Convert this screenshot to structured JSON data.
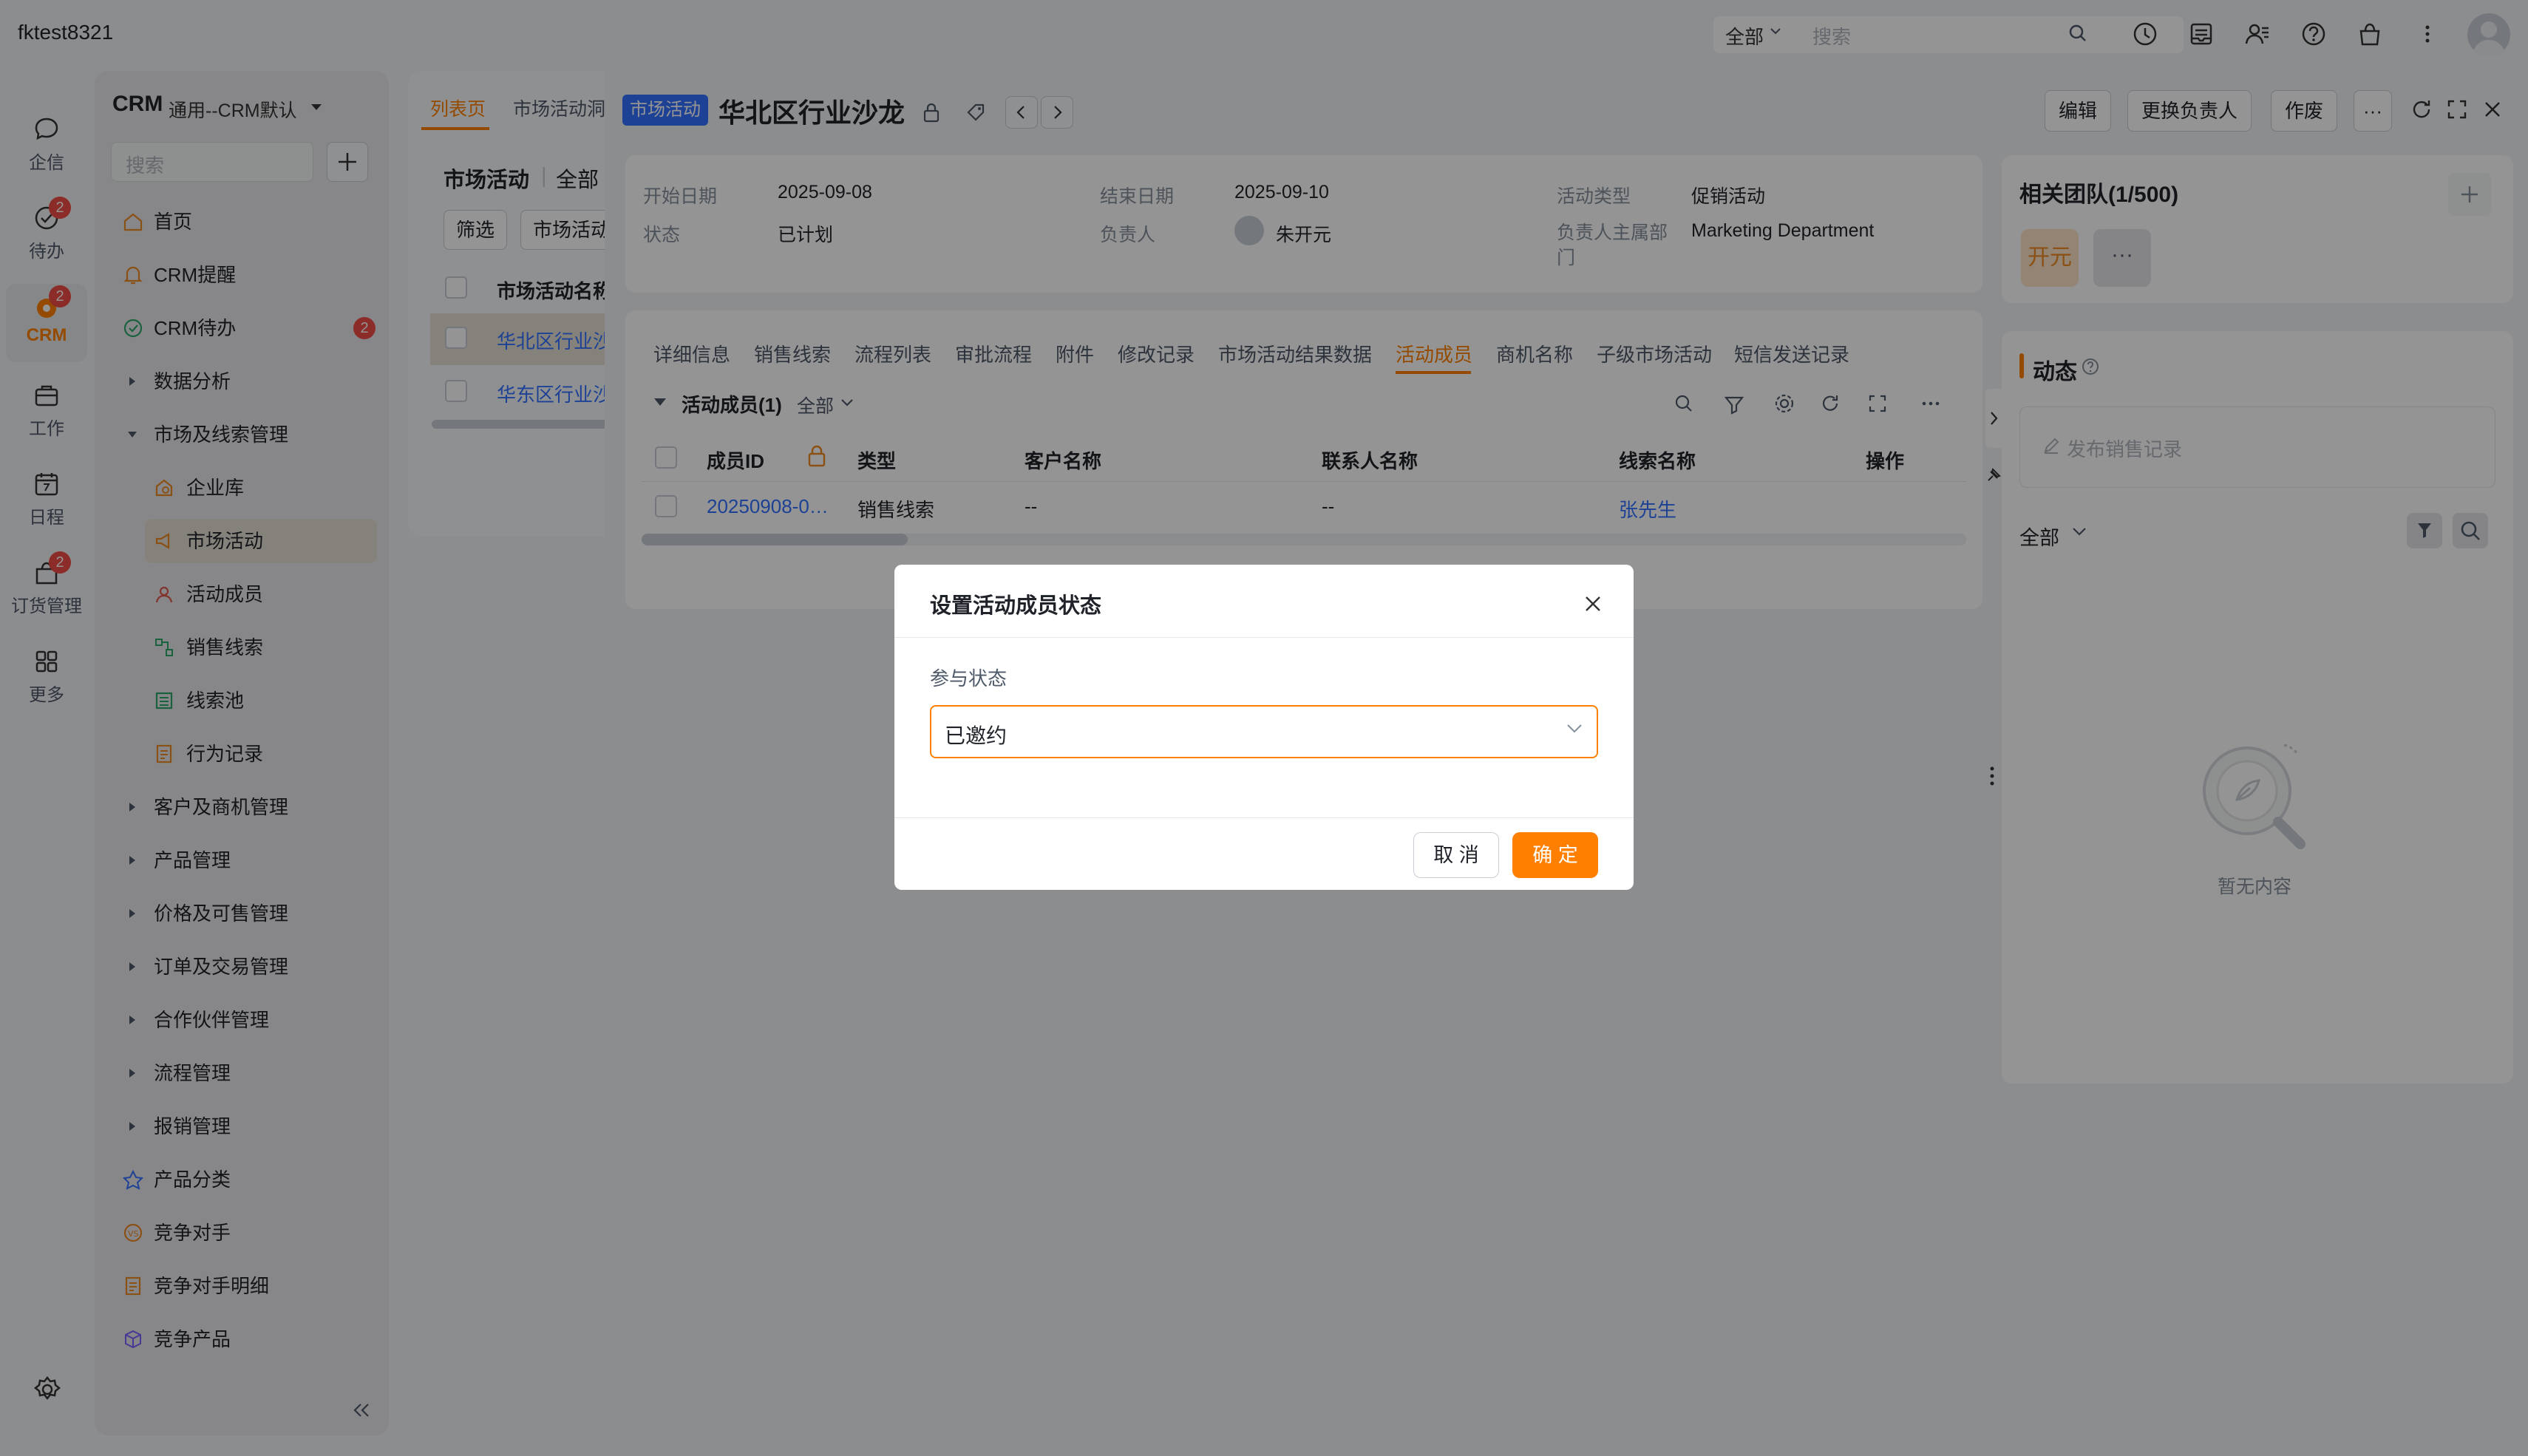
{
  "topbar": {
    "account": "fktest8321",
    "scope": "全部",
    "search_placeholder": "搜索",
    "icons": [
      "clock-icon",
      "inbox-icon",
      "contacts-icon",
      "help-icon",
      "bag-icon",
      "more-vertical-icon"
    ]
  },
  "rail": {
    "items": [
      {
        "label": "企信",
        "icon": "chat-icon"
      },
      {
        "label": "待办",
        "icon": "check-circle-icon",
        "badge": "2"
      },
      {
        "label": "CRM",
        "icon": "crm-icon",
        "badge": "2"
      },
      {
        "label": "工作",
        "icon": "briefcase-icon"
      },
      {
        "label": "日程",
        "icon": "calendar-icon"
      },
      {
        "label": "订货管理",
        "icon": "order-icon",
        "badge": "2"
      },
      {
        "label": "更多",
        "icon": "grid-icon"
      }
    ]
  },
  "nav": {
    "title": "CRM",
    "subtitle": "通用--CRM默认",
    "search_placeholder": "搜索",
    "items": [
      {
        "label": "首页"
      },
      {
        "label": "CRM提醒"
      },
      {
        "label": "CRM待办",
        "badge": "2"
      },
      {
        "label": "数据分析"
      },
      {
        "label": "市场及线索管理"
      },
      {
        "label": "企业库"
      },
      {
        "label": "市场活动"
      },
      {
        "label": "活动成员"
      },
      {
        "label": "销售线索"
      },
      {
        "label": "线索池"
      },
      {
        "label": "行为记录"
      },
      {
        "label": "客户及商机管理"
      },
      {
        "label": "产品管理"
      },
      {
        "label": "价格及可售管理"
      },
      {
        "label": "订单及交易管理"
      },
      {
        "label": "合作伙伴管理"
      },
      {
        "label": "流程管理"
      },
      {
        "label": "报销管理"
      },
      {
        "label": "产品分类"
      },
      {
        "label": "竞争对手"
      },
      {
        "label": "竞争对手明细"
      },
      {
        "label": "竞争产品"
      }
    ]
  },
  "list": {
    "tabs": [
      "列表页",
      "市场活动洞"
    ],
    "title": "市场活动",
    "scope": "全部",
    "filter_btn": "筛选",
    "view_btn": "市场活动",
    "col_header": "市场活动名称",
    "rows": [
      "华北区行业沙",
      "华东区行业沙"
    ]
  },
  "detail": {
    "tag": "市场活动",
    "title": "华北区行业沙龙",
    "buttons": {
      "edit": "编辑",
      "change_owner": "更换负责人",
      "void": "作废",
      "more": "···"
    },
    "info": {
      "start_label": "开始日期",
      "start_value": "2025-09-08",
      "end_label": "结束日期",
      "end_value": "2025-09-10",
      "type_label": "活动类型",
      "type_value": "促销活动",
      "status_label": "状态",
      "status_value": "已计划",
      "owner_label": "负责人",
      "owner_value": "朱开元",
      "dept_label": "负责人主属部门",
      "dept_value": "Marketing Department"
    },
    "tabs": [
      "详细信息",
      "销售线索",
      "流程列表",
      "审批流程",
      "附件",
      "修改记录",
      "市场活动结果数据",
      "活动成员",
      "商机名称",
      "子级市场活动",
      "短信发送记录"
    ],
    "active_tab": "活动成员",
    "members": {
      "title": "活动成员(1)",
      "scope": "全部",
      "columns": [
        "成员ID",
        "类型",
        "客户名称",
        "联系人名称",
        "线索名称",
        "操作"
      ],
      "rows": [
        {
          "id": "20250908-0…",
          "type": "销售线索",
          "customer": "--",
          "contact": "--",
          "lead": "张先生",
          "action": ""
        }
      ]
    }
  },
  "right": {
    "team_title": "相关团队(1/500)",
    "team_avatar": "开元",
    "team_more": "···",
    "dyn_title": "动态",
    "post_placeholder": "发布销售记录",
    "dyn_scope": "全部",
    "empty": "暂无内容"
  },
  "modal": {
    "title": "设置活动成员状态",
    "field_label": "参与状态",
    "field_value": "已邀约",
    "cancel": "取 消",
    "ok": "确 定"
  },
  "colors": {
    "accent": "#ff8000",
    "link": "#3370ff",
    "badge": "#f04c45"
  }
}
